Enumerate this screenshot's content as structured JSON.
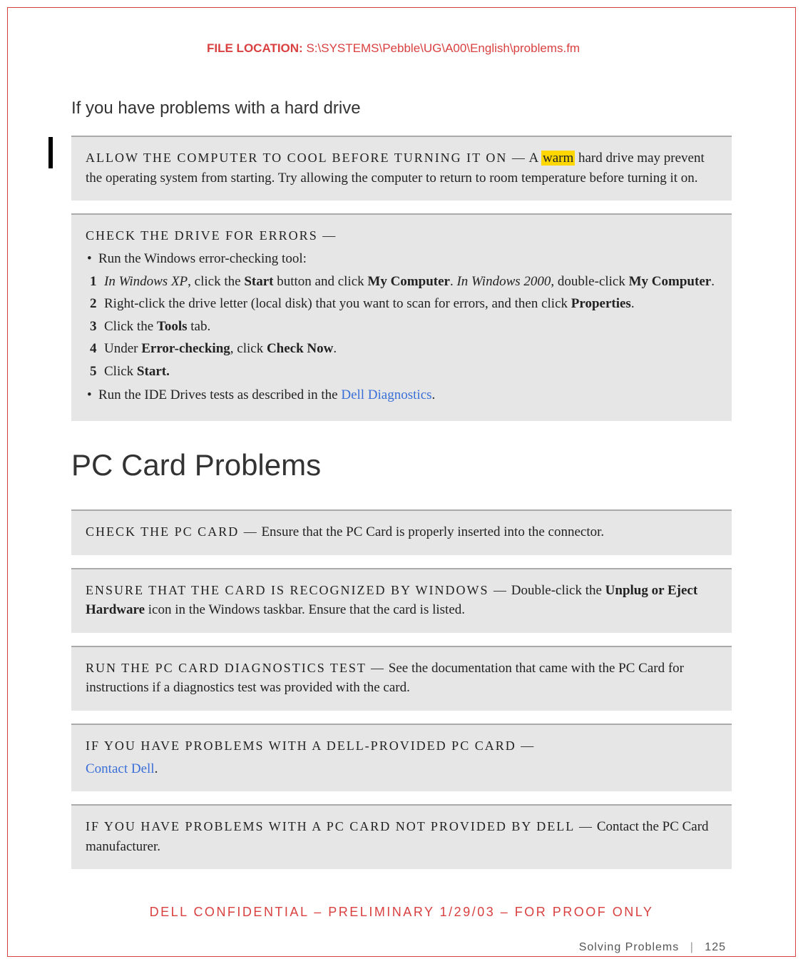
{
  "header": {
    "file_location_label": "FILE LOCATION:",
    "file_location_path": "S:\\SYSTEMS\\Pebble\\UG\\A00\\English\\problems.fm"
  },
  "subsection_title": "If you have problems with a hard drive",
  "box_cool": {
    "title_sc": "ALLOW THE COMPUTER TO COOL BEFORE TURNING IT ON —",
    "lead_text_pre": " A ",
    "highlight": "warm",
    "body": " hard drive may prevent the operating system from starting. Try allowing the computer to return to room temperature before turning it on."
  },
  "box_errors": {
    "title_sc": "CHECK THE DRIVE FOR ERRORS —",
    "bullet_intro": "Run the Windows error-checking tool:",
    "steps": {
      "s1_pre_italic": "In Windows XP",
      "s1_mid1": ", click the ",
      "s1_bold1": "Start",
      "s1_mid2": " button and click ",
      "s1_bold2": "My Computer",
      "s1_mid3": ". ",
      "s1_italic2": "In Windows 2000",
      "s1_mid4": ", double-click ",
      "s1_bold3": "My Computer",
      "s1_end": ".",
      "s2_pre": "Right-click the drive letter (local disk) that you want to scan for errors, and then click ",
      "s2_bold": "Properties",
      "s2_end": ".",
      "s3_pre": "Click the ",
      "s3_bold": "Tools",
      "s3_end": " tab.",
      "s4_pre": "Under ",
      "s4_bold1": "Error-checking",
      "s4_mid": ", click ",
      "s4_bold2": "Check Now",
      "s4_end": ".",
      "s5_pre": "Click ",
      "s5_bold": "Start.",
      "s5_end": ""
    },
    "bullet_outro_pre": "Run the IDE Drives tests as described in the ",
    "bullet_outro_link": "Dell Diagnostics",
    "bullet_outro_end": "."
  },
  "section_title": "PC Card Problems",
  "box_pc1": {
    "title_sc": "CHECK THE PC CARD —",
    "body": " Ensure that the PC Card is properly inserted into the connector."
  },
  "box_pc2": {
    "title_sc": "ENSURE THAT THE CARD IS RECOGNIZED BY WINDOWS —",
    "body_pre": " Double-click the ",
    "body_bold": "Unplug or Eject Hardware",
    "body_post": " icon in the Windows taskbar. Ensure that the card is listed."
  },
  "box_pc3": {
    "title_sc": "RUN THE PC CARD DIAGNOSTICS TEST —",
    "body": " See the documentation that came with the PC Card for instructions if a diagnostics test was provided with the card."
  },
  "box_pc4": {
    "title_sc": "IF YOU HAVE PROBLEMS WITH A DELL-PROVIDED PC CARD —",
    "link": "Contact Dell",
    "end": "."
  },
  "box_pc5": {
    "title_sc": "IF YOU HAVE PROBLEMS WITH A PC CARD NOT PROVIDED BY DELL —",
    "body": " Contact the PC Card manufacturer."
  },
  "footer": {
    "confidential": "DELL CONFIDENTIAL – PRELIMINARY 1/29/03 – FOR PROOF ONLY",
    "section_name": "Solving Problems",
    "page_num": "125"
  }
}
